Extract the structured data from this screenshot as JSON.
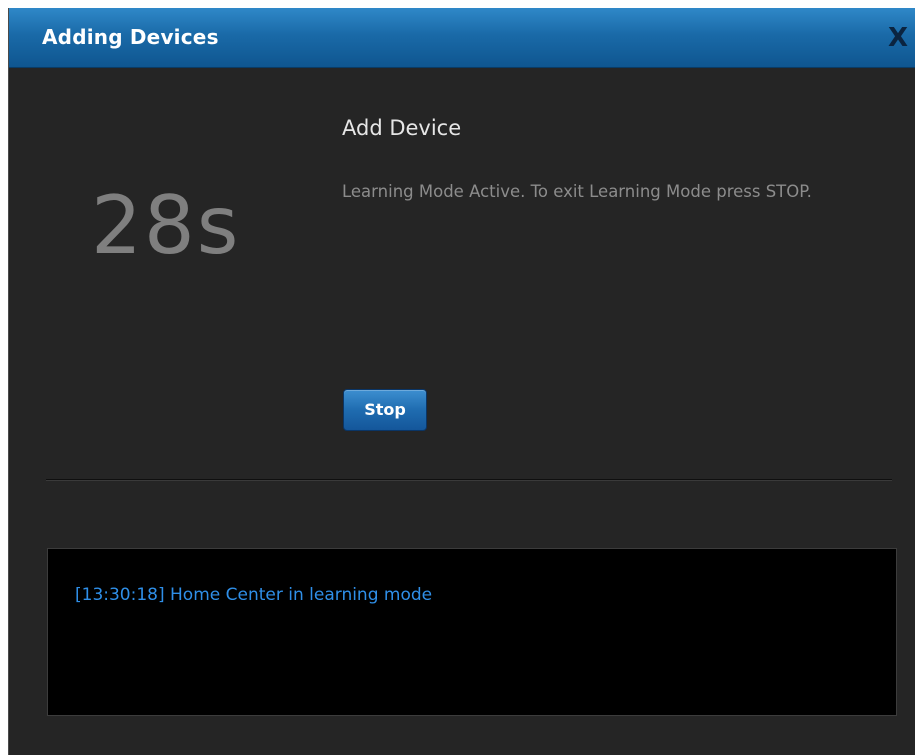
{
  "dialog": {
    "title": "Adding Devices",
    "close_label": "X"
  },
  "countdown": {
    "value": "28s"
  },
  "content": {
    "heading": "Add Device",
    "message": "Learning Mode Active. To exit Learning Mode press STOP.",
    "stop_label": "Stop"
  },
  "log": {
    "entries": [
      "[13:30:18] Home Center in learning mode"
    ]
  },
  "colors": {
    "titlebar": "#1a6aa8",
    "background": "#252525",
    "log_text": "#2f8fe8",
    "countdown": "#7f7f7f"
  }
}
